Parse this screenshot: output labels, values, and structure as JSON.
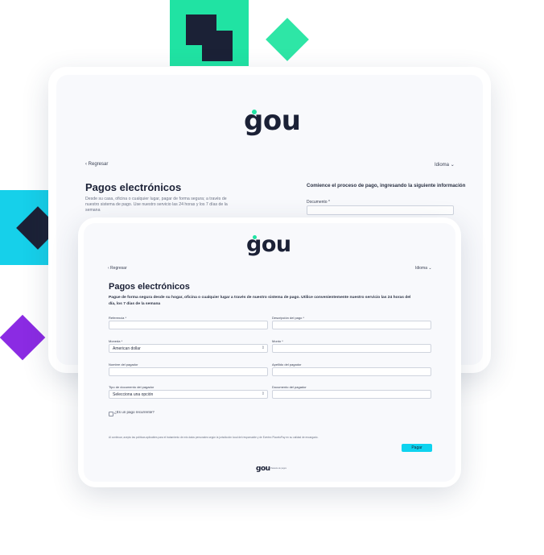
{
  "colors": {
    "green": "#20e3a3",
    "cyan": "#16d0ea",
    "purple": "#8b2be3",
    "navy": "#1b2136",
    "button": "#0fd3ef"
  },
  "icons": {
    "back": "chevron-left-icon",
    "dropdown": "chevron-down-icon",
    "select": "up-down-chevron-icon"
  },
  "back_screen": {
    "logo": "gou",
    "back_link": "‹ Regresar",
    "language": "Idioma",
    "title": "Pagos electrónicos",
    "description_1": "Desde su casa, oficina o cualquier lugar, pagar de forma segura; a través de",
    "description_2": "nuestro sistema de pago. Use nuestro servicio las 24 horas y los 7 días de la",
    "description_3": "semana",
    "side_heading": "Comience el proceso de pago, ingresando la siguiente información",
    "document_label": "Documento *"
  },
  "front_screen": {
    "logo": "gou",
    "back_link": "‹ Regresar",
    "language": "Idioma",
    "title": "Pagos electrónicos",
    "subtitle_1": "Pague de forma segura desde su hogar, oficina o cualquier lugar a través de nuestro sistema de pago. Utilice convenientemente nuestro servicio las 24 horas del",
    "subtitle_2": "día, los 7 días de la semana",
    "fields": {
      "referencia": "Referencia *",
      "descripcion": "Descripción del pago *",
      "moneda": "Moneda *",
      "moneda_value": "American dollar",
      "monto": "Monto *",
      "nombre": "Nombre del pagador",
      "apellido": "Apellido del pagador",
      "tipo_doc": "Tipo de documento del pagador",
      "tipo_doc_value": "Selecciona una opción",
      "documento": "Documento del pagador"
    },
    "recurrent_label": "¿Es un pago recurrente?",
    "terms": "Al continuar, acepto las políticas aplicables para el tratamiento de mis datos personales según la jurisdicción local del responsable y de Evertec PlacetoPay en su calidad de encargado.",
    "pay_button": "Pagar",
    "footer_logo": "gou",
    "footer_tagline": "Pasarela de pagos"
  }
}
